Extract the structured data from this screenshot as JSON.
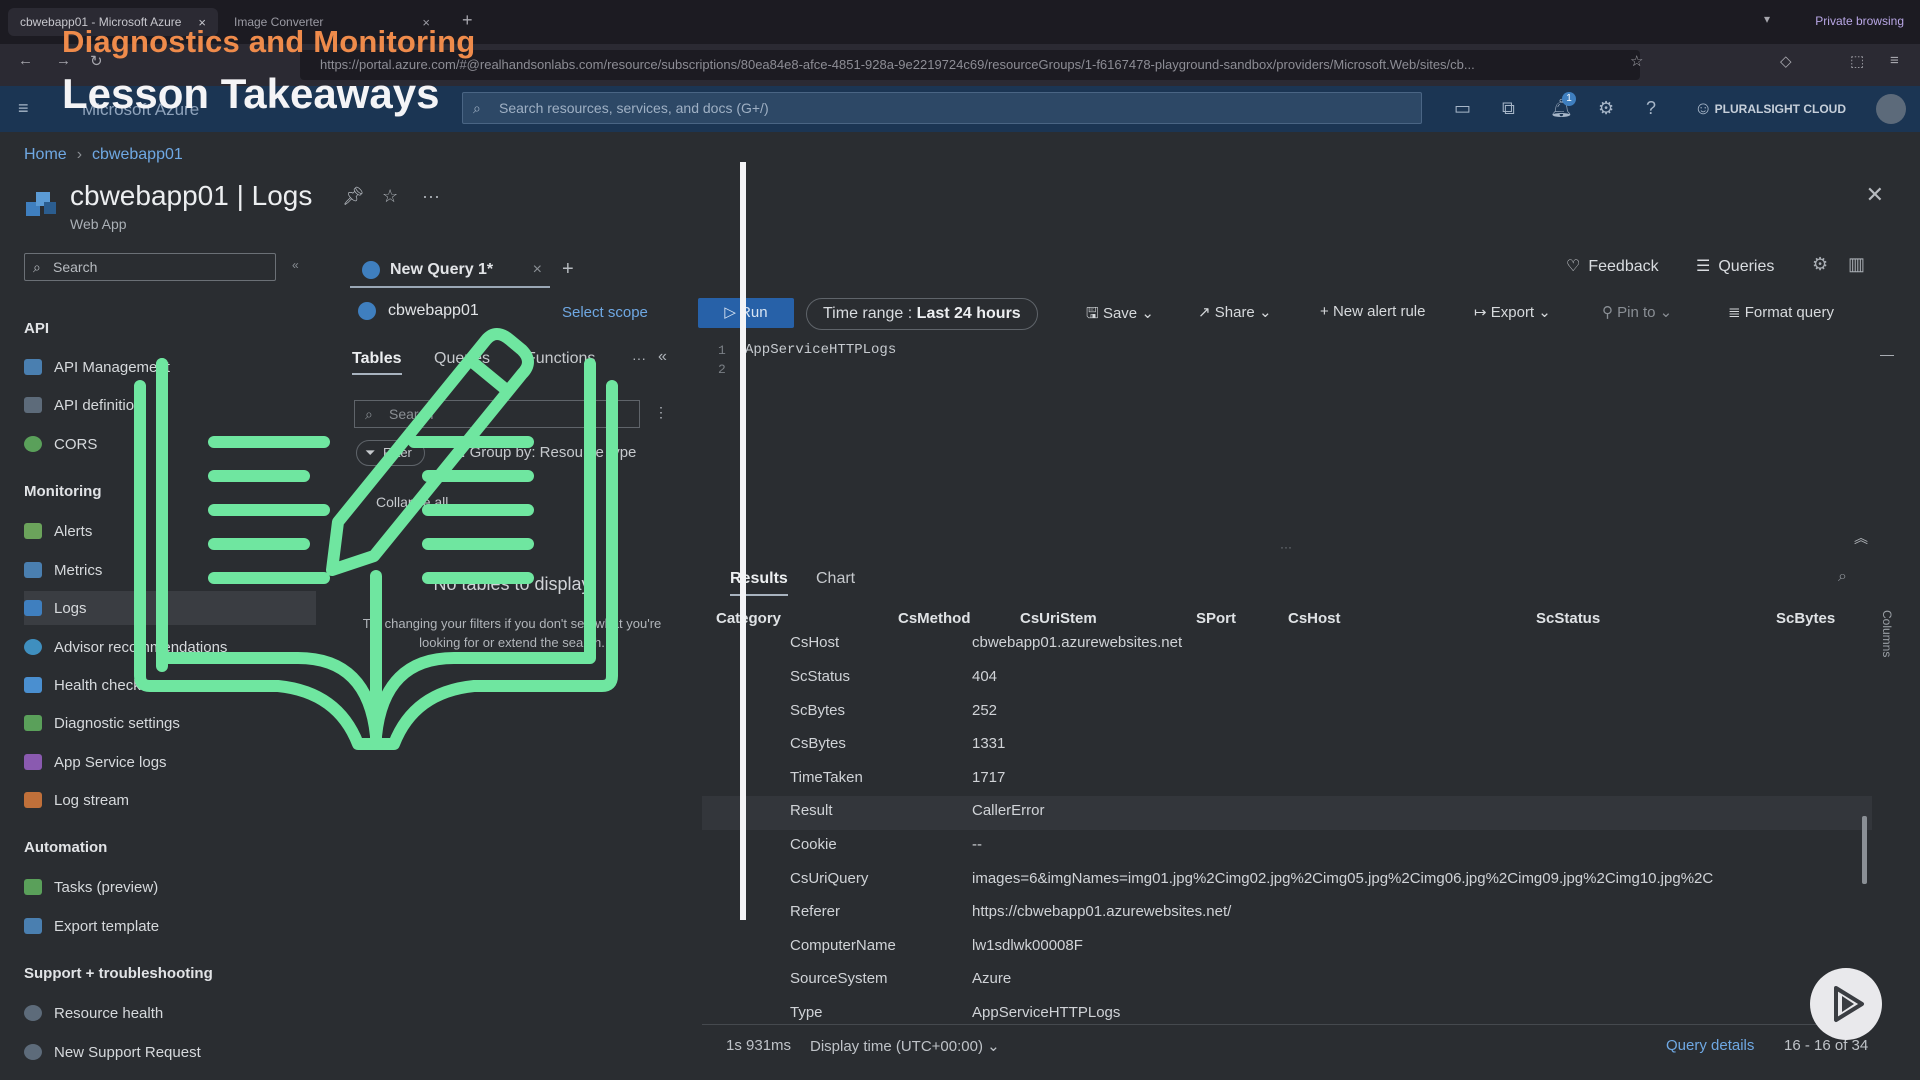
{
  "browser": {
    "tabs": [
      {
        "label": "cbwebapp01 - Microsoft Azure",
        "active": true
      },
      {
        "label": "Image Converter",
        "active": false
      }
    ],
    "private_label": "Private browsing",
    "url": "https://portal.azure.com/#@realhandsonlabs.com/resource/subscriptions/80ea84e8-afce-4851-928a-9e2219724c69/resourceGroups/1-f6167478-playground-sandbox/providers/Microsoft.Web/sites/cb..."
  },
  "overlay": {
    "title": "Diagnostics and Monitoring",
    "subtitle": "Lesson Takeaways"
  },
  "azure": {
    "brand": "Microsoft Azure",
    "search_placeholder": "Search resources, services, and docs (G+/)",
    "account": "PLURALSIGHT CLOUD",
    "notification_count": "1"
  },
  "breadcrumb": [
    "Home",
    "cbwebapp01"
  ],
  "resource": {
    "title": "cbwebapp01 | Logs",
    "type": "Web App"
  },
  "menu": {
    "search_placeholder": "Search",
    "sections": [
      {
        "title": "API",
        "items": [
          "API Management",
          "API definition",
          "CORS"
        ]
      },
      {
        "title": "Monitoring",
        "items": [
          "Alerts",
          "Metrics",
          "Logs",
          "Advisor recommendations",
          "Health check",
          "Diagnostic settings",
          "App Service logs",
          "Log stream"
        ]
      },
      {
        "title": "Automation",
        "items": [
          "Tasks (preview)",
          "Export template"
        ]
      },
      {
        "title": "Support + troubleshooting",
        "items": [
          "Resource health",
          "New Support Request"
        ]
      }
    ],
    "selected": "Logs"
  },
  "query": {
    "tab_label": "New Query 1*",
    "scope": "cbwebapp01",
    "select_scope": "Select scope",
    "run": "Run",
    "time_range_label": "Time range :",
    "time_range_value": "Last 24 hours",
    "toolbar": [
      "Save",
      "Share",
      "New alert rule",
      "Export",
      "Pin to",
      "Format query"
    ],
    "feedback": "Feedback",
    "queries": "Queries",
    "editor_lines": [
      "AppServiceHTTPLogs",
      ""
    ]
  },
  "left_panel": {
    "tabs": [
      "Tables",
      "Queries",
      "Functions"
    ],
    "search_placeholder": "Search",
    "filter": "Filter",
    "group_by": "Group by: Resource type",
    "collapse_all": "Collapse all",
    "empty_title": "No tables to display",
    "empty_hint": "Try changing your filters if you don't see what you're looking for or extend the search."
  },
  "results": {
    "tabs": [
      "Results",
      "Chart"
    ],
    "columns": [
      "Category",
      "CsMethod",
      "CsUriStem",
      "SPort",
      "CsHost",
      "ScStatus",
      "ScBytes"
    ],
    "side_label": "Columns",
    "rows": [
      {
        "key": "CsHost",
        "value": "cbwebapp01.azurewebsites.net"
      },
      {
        "key": "ScStatus",
        "value": "404"
      },
      {
        "key": "ScBytes",
        "value": "252"
      },
      {
        "key": "CsBytes",
        "value": "1331"
      },
      {
        "key": "TimeTaken",
        "value": "1717"
      },
      {
        "key": "Result",
        "value": "CallerError"
      },
      {
        "key": "Cookie",
        "value": "--"
      },
      {
        "key": "CsUriQuery",
        "value": "images=6&imgNames=img01.jpg%2Cimg02.jpg%2Cimg05.jpg%2Cimg06.jpg%2Cimg09.jpg%2Cimg10.jpg%2C"
      },
      {
        "key": "Referer",
        "value": "https://cbwebapp01.azurewebsites.net/"
      },
      {
        "key": "ComputerName",
        "value": "lw1sdlwk00008F"
      },
      {
        "key": "SourceSystem",
        "value": "Azure"
      },
      {
        "key": "Type",
        "value": "AppServiceHTTPLogs"
      }
    ],
    "duration": "1s 931ms",
    "display_time": "Display time (UTC+00:00)",
    "query_details": "Query details",
    "count": "16 - 16 of 34"
  },
  "colors": {
    "overlay_title": "#ef8b4b",
    "accent_green": "#6fe6a0",
    "azure_blue": "#2761a8"
  }
}
